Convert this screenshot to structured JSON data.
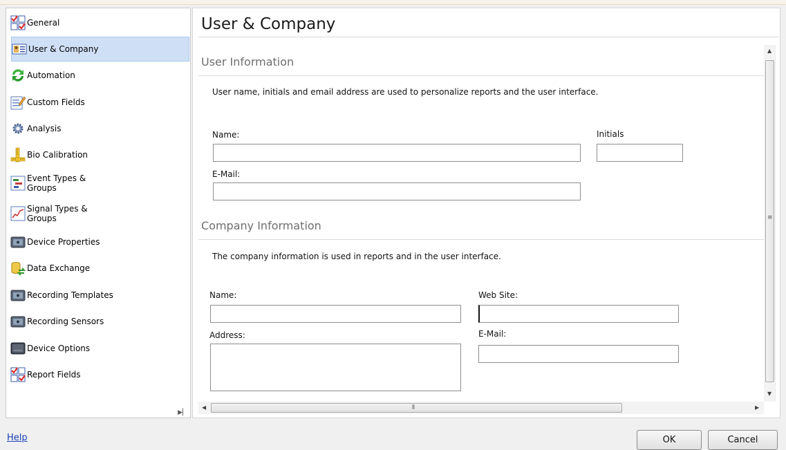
{
  "sidebar": {
    "items": [
      {
        "label": "General",
        "icon": "checklist-grid-icon"
      },
      {
        "label": "User & Company",
        "icon": "user-card-icon"
      },
      {
        "label": "Automation",
        "icon": "green-refresh-icon"
      },
      {
        "label": "Custom Fields",
        "icon": "form-edit-icon"
      },
      {
        "label": "Analysis",
        "icon": "gears-icon"
      },
      {
        "label": "Bio Calibration",
        "icon": "ruler-icon"
      },
      {
        "label": "Event Types &\nGroups",
        "icon": "event-list-icon"
      },
      {
        "label": "Signal Types &\nGroups",
        "icon": "signal-graph-icon"
      },
      {
        "label": "Device Properties",
        "icon": "device-icon"
      },
      {
        "label": "Data Exchange",
        "icon": "database-exchange-icon"
      },
      {
        "label": "Recording Templates",
        "icon": "device-icon"
      },
      {
        "label": "Recording Sensors",
        "icon": "device-icon"
      },
      {
        "label": "Device Options",
        "icon": "device-dark-icon"
      },
      {
        "label": "Report Fields",
        "icon": "checklist-grid-icon"
      }
    ],
    "selected_index": 1
  },
  "main": {
    "title": "User & Company",
    "user_section": {
      "title": "User Information",
      "description": "User name, initials and email address are used to personalize reports and the user interface.",
      "name_label": "Name:",
      "name_value": "",
      "initials_label": "Initials",
      "initials_value": "",
      "email_label": "E-Mail:",
      "email_value": ""
    },
    "company_section": {
      "title": "Company Information",
      "description": "The company information is used in reports and in the user interface.",
      "name_label": "Name:",
      "name_value": "",
      "website_label": "Web Site:",
      "website_value": "",
      "address_label": "Address:",
      "address_value": "",
      "email_label": "E-Mail:",
      "email_value": ""
    }
  },
  "footer": {
    "help_label": "Help",
    "ok_label": "OK",
    "cancel_label": "Cancel"
  },
  "colors": {
    "selected_bg": "#cfe0f6",
    "link": "#1a3fb6",
    "section_title": "#6e6e6e"
  }
}
